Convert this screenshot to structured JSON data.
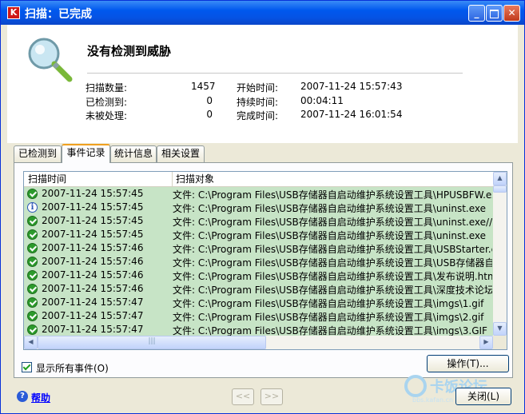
{
  "window": {
    "title": "扫描：已完成",
    "app_icon": "K"
  },
  "summary": {
    "status": "没有检测到威胁",
    "scanned_label": "扫描数量:",
    "scanned_value": "1457",
    "detected_label": "已检测到:",
    "detected_value": "0",
    "untreated_label": "未被处理:",
    "untreated_value": "0",
    "start_label": "开始时间:",
    "start_value": "2007-11-24 15:57:43",
    "duration_label": "持续时间:",
    "duration_value": "00:04:11",
    "finish_label": "完成时间:",
    "finish_value": "2007-11-24 16:01:54"
  },
  "tabs": [
    {
      "label": "已检测到",
      "active": false
    },
    {
      "label": "事件记录",
      "active": true
    },
    {
      "label": "统计信息",
      "active": false
    },
    {
      "label": "相关设置",
      "active": false
    }
  ],
  "table": {
    "columns": [
      "扫描时间",
      "扫描对象"
    ],
    "rows": [
      {
        "icon": "ok",
        "time": "2007-11-24 15:57:45",
        "object": "文件: C:\\Program Files\\USB存储器自启动维护系统设置工具\\HPUSBFW.exe"
      },
      {
        "icon": "info",
        "time": "2007-11-24 15:57:45",
        "object": "文件: C:\\Program Files\\USB存储器自启动维护系统设置工具\\uninst.exe"
      },
      {
        "icon": "ok",
        "time": "2007-11-24 15:57:45",
        "object": "文件: C:\\Program Files\\USB存储器自启动维护系统设置工具\\uninst.exe//data"
      },
      {
        "icon": "ok",
        "time": "2007-11-24 15:57:45",
        "object": "文件: C:\\Program Files\\USB存储器自启动维护系统设置工具\\uninst.exe"
      },
      {
        "icon": "ok",
        "time": "2007-11-24 15:57:46",
        "object": "文件: C:\\Program Files\\USB存储器自启动维护系统设置工具\\USBStarter.exe"
      },
      {
        "icon": "ok",
        "time": "2007-11-24 15:57:46",
        "object": "文件: C:\\Program Files\\USB存储器自启动维护系统设置工具\\USB存储器自启"
      },
      {
        "icon": "ok",
        "time": "2007-11-24 15:57:46",
        "object": "文件: C:\\Program Files\\USB存储器自启动维护系统设置工具\\发布说明.html"
      },
      {
        "icon": "ok",
        "time": "2007-11-24 15:57:46",
        "object": "文件: C:\\Program Files\\USB存储器自启动维护系统设置工具\\深度技术论坛USB"
      },
      {
        "icon": "ok",
        "time": "2007-11-24 15:57:47",
        "object": "文件: C:\\Program Files\\USB存储器自启动维护系统设置工具\\imgs\\1.gif"
      },
      {
        "icon": "ok",
        "time": "2007-11-24 15:57:47",
        "object": "文件: C:\\Program Files\\USB存储器自启动维护系统设置工具\\imgs\\2.gif"
      },
      {
        "icon": "ok",
        "time": "2007-11-24 15:57:47",
        "object": "文件: C:\\Program Files\\USB存储器自启动维护系统设置工具\\imgs\\3.GIF"
      }
    ]
  },
  "actions_button": "操作(T)...",
  "show_all_events": {
    "label": "显示所有事件(O)",
    "checked": true
  },
  "help_label": "帮助",
  "nav": {
    "prev": "<<",
    "next": ">>"
  },
  "close_button": "关闭(L)",
  "watermark": {
    "text": "卡饭论坛",
    "sub": "bbs.kafan.cn"
  },
  "colors": {
    "title_bar": "#0058ee",
    "row_ok": "#c7e4c6",
    "link": "#0000ff"
  }
}
